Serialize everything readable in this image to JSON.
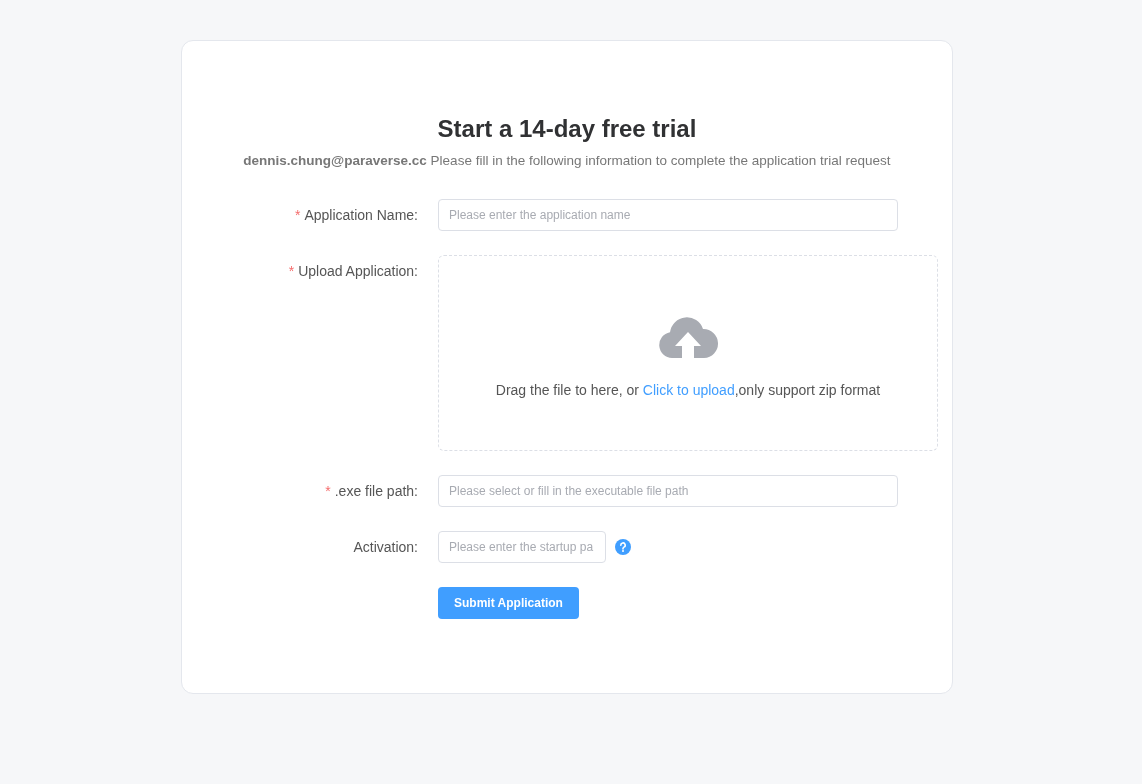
{
  "title": "Start a 14-day free trial",
  "subtitle": {
    "email": "dennis.chung@paraverse.cc",
    "text": "Please fill in the following information to complete the application trial request"
  },
  "fields": [
    {
      "kind": "text",
      "marker": "*",
      "label": "Application Name:",
      "placeholder": "Please enter the application name"
    },
    {
      "kind": "upload",
      "marker": "*",
      "label": "Upload Application:",
      "text_before": "Drag the file to here, or ",
      "link": "Click to upload",
      "text_after": ",only support zip format"
    },
    {
      "kind": "text",
      "marker": "*",
      "label": ".exe file path:",
      "placeholder": "Please select or fill in the executable file path"
    },
    {
      "kind": "short",
      "label": "Activation:",
      "placeholder": "Please enter the startup pa"
    }
  ],
  "submit": "Submit Application"
}
